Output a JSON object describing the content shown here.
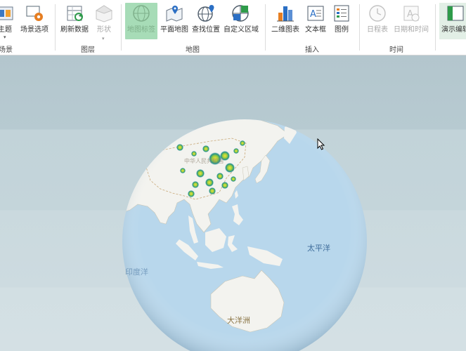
{
  "ribbon": {
    "buttons": [
      {
        "id": "theme",
        "label": "主题"
      },
      {
        "id": "scene_options",
        "label": "场景选项"
      },
      {
        "id": "refresh",
        "label": "刷新数据"
      },
      {
        "id": "shape",
        "label": "形状"
      },
      {
        "id": "map_labels",
        "label": "地图标签"
      },
      {
        "id": "flat_map",
        "label": "平面地图"
      },
      {
        "id": "find_location",
        "label": "查找位置"
      },
      {
        "id": "custom_region",
        "label": "自定义区域"
      },
      {
        "id": "chart_2d",
        "label": "二维图表"
      },
      {
        "id": "text_box",
        "label": "文本框"
      },
      {
        "id": "legend",
        "label": "图例"
      },
      {
        "id": "timeline",
        "label": "日程表"
      },
      {
        "id": "date_time",
        "label": "日期和时间"
      },
      {
        "id": "tour_editor",
        "label": "演示编辑"
      }
    ],
    "groups": {
      "scene": "场景",
      "layer": "图层",
      "map": "地图",
      "insert": "插入",
      "time": "时间"
    }
  },
  "map": {
    "labels": {
      "pacific": "太平洋",
      "oceania": "大洋洲",
      "indian_ocean": "印度洋",
      "china_faint": "中华人民共和国"
    },
    "colors": {
      "ocean": "#b8d7ec",
      "land": "#f3f3ef",
      "heat_low": "#1f8f8a",
      "heat_high": "#f1e23a"
    }
  }
}
